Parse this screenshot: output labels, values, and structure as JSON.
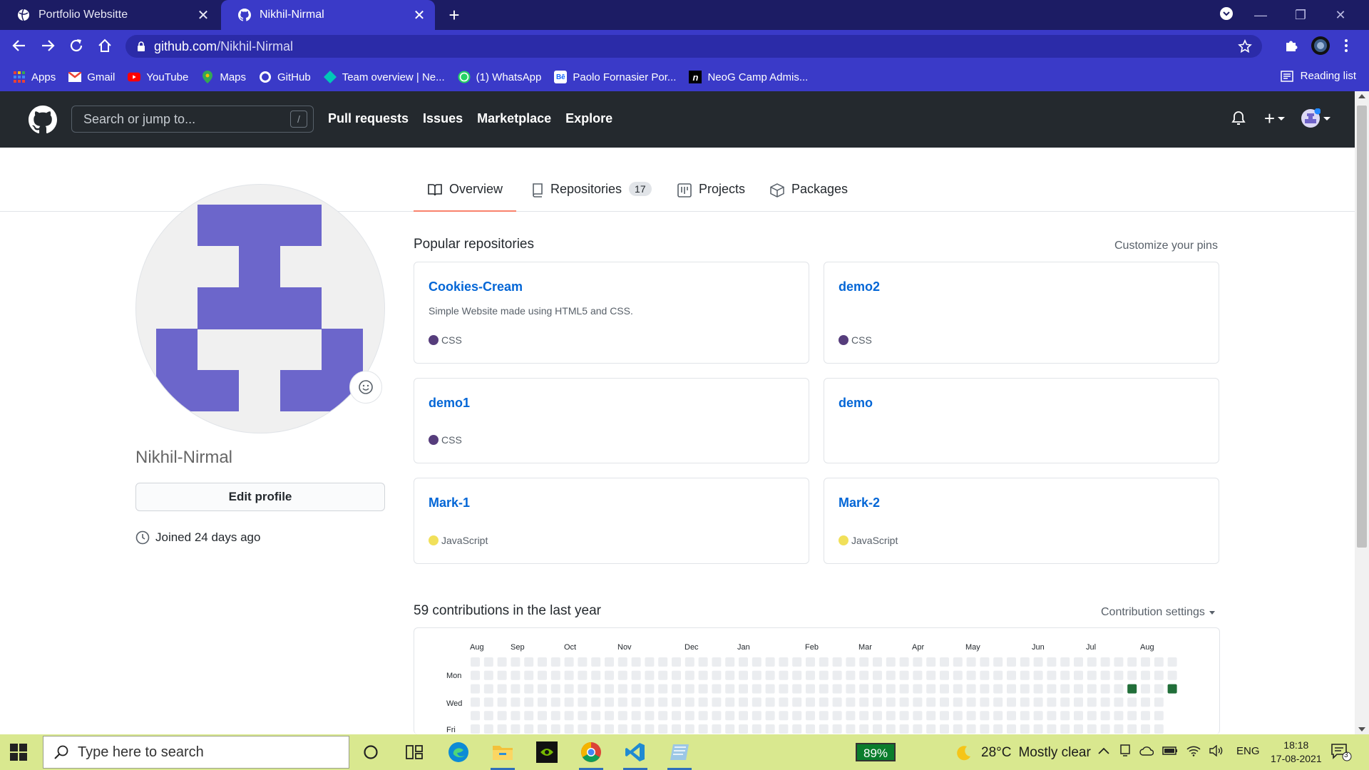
{
  "browser": {
    "tabs": [
      {
        "title": "Portfolio Websitte",
        "active": false
      },
      {
        "title": "Nikhil-Nirmal",
        "active": true
      }
    ],
    "url_host": "github.com",
    "url_path": "/Nikhil-Nirmal",
    "bookmarks": [
      {
        "label": "Apps",
        "icon": "apps-grid-icon"
      },
      {
        "label": "Gmail",
        "icon": "gmail-icon"
      },
      {
        "label": "YouTube",
        "icon": "youtube-icon"
      },
      {
        "label": "Maps",
        "icon": "maps-icon"
      },
      {
        "label": "GitHub",
        "icon": "github-icon"
      },
      {
        "label": "Team overview | Ne...",
        "icon": "team-icon"
      },
      {
        "label": "(1) WhatsApp",
        "icon": "whatsapp-icon"
      },
      {
        "label": "Paolo Fornasier Por...",
        "icon": "behance-icon"
      },
      {
        "label": "NeoG Camp Admis...",
        "icon": "neog-icon"
      }
    ],
    "reading_list": "Reading list"
  },
  "github": {
    "search_placeholder": "Search or jump to...",
    "search_shortcut": "/",
    "nav": [
      "Pull requests",
      "Issues",
      "Marketplace",
      "Explore"
    ]
  },
  "profile": {
    "tabs": [
      {
        "label": "Overview",
        "selected": true
      },
      {
        "label": "Repositories",
        "count": "17"
      },
      {
        "label": "Projects"
      },
      {
        "label": "Packages"
      }
    ],
    "username": "Nikhil-Nirmal",
    "edit_profile": "Edit profile",
    "joined": "Joined 24 days ago"
  },
  "popular": {
    "title": "Popular repositories",
    "customize": "Customize your pins",
    "repos": [
      {
        "name": "Cookies-Cream",
        "description": "Simple Website made using HTML5 and CSS.",
        "language": "CSS",
        "color": "#563d7c"
      },
      {
        "name": "demo2",
        "description": "",
        "language": "CSS",
        "color": "#563d7c"
      },
      {
        "name": "demo1",
        "description": "",
        "language": "CSS",
        "color": "#563d7c"
      },
      {
        "name": "demo",
        "description": "",
        "language": "",
        "color": ""
      },
      {
        "name": "Mark-1",
        "description": "",
        "language": "JavaScript",
        "color": "#f1e05a"
      },
      {
        "name": "Mark-2",
        "description": "",
        "language": "JavaScript",
        "color": "#f1e05a"
      }
    ]
  },
  "contributions": {
    "title": "59 contributions in the last year",
    "settings": "Contribution settings",
    "months": [
      "Aug",
      "Sep",
      "Oct",
      "Nov",
      "Dec",
      "Jan",
      "Feb",
      "Mar",
      "Apr",
      "May",
      "Jun",
      "Jul",
      "Aug"
    ],
    "days": [
      "Mon",
      "Wed",
      "Fri"
    ],
    "colors": {
      "empty": "#ebedf0",
      "active": "#216e39"
    }
  },
  "taskbar": {
    "search_placeholder": "Type here to search",
    "battery": "89%",
    "temperature": "28°C",
    "weather": "Mostly clear",
    "language": "ENG",
    "time": "18:18",
    "date": "17-08-2021",
    "notifications": "3"
  }
}
